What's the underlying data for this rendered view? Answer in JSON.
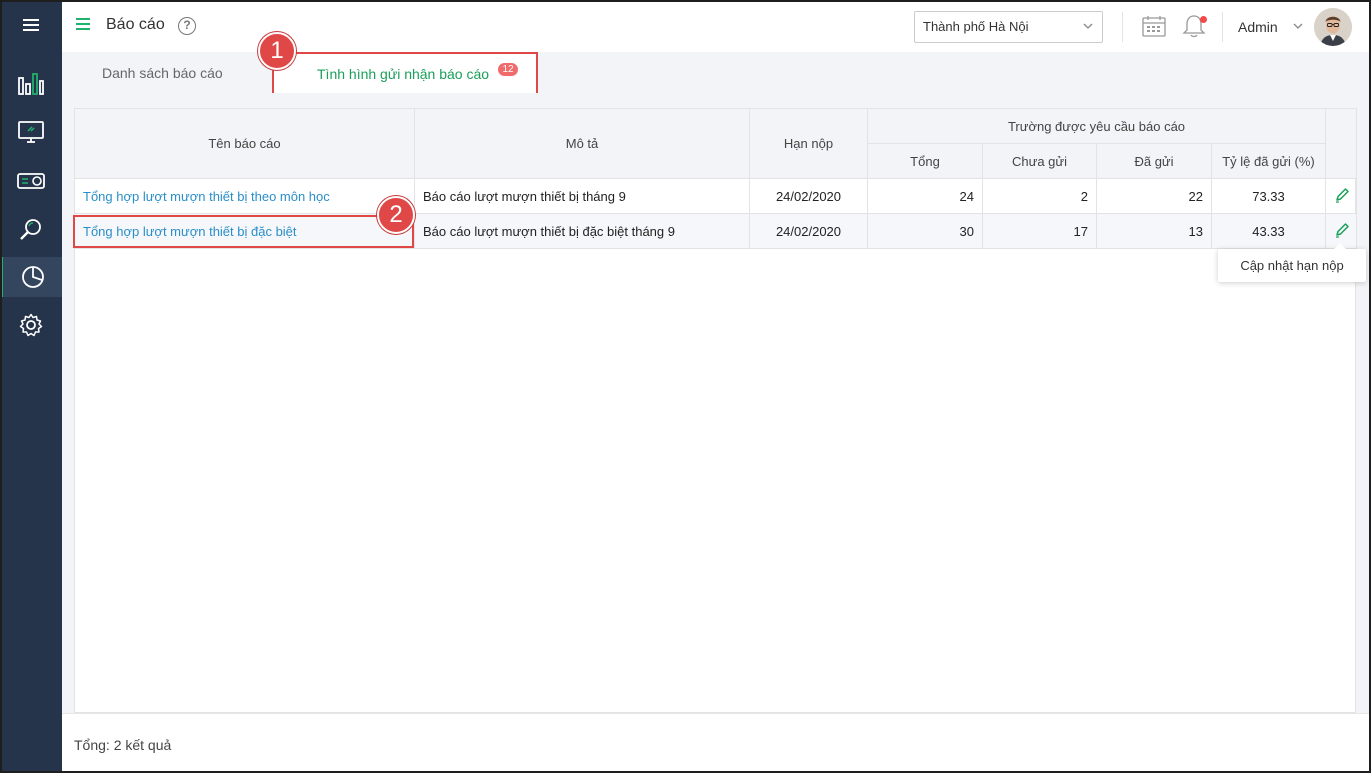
{
  "header": {
    "title": "Báo cáo",
    "help": "?",
    "city_select": "Thành phố Hà Nội",
    "user": "Admin"
  },
  "tabs": [
    {
      "label": "Danh sách báo cáo",
      "active": false
    },
    {
      "label": "Tình hình gửi nhận báo cáo",
      "active": true,
      "badge": "12"
    }
  ],
  "callouts": [
    "1",
    "2"
  ],
  "table": {
    "headers": {
      "name": "Tên báo cáo",
      "desc": "Mô tả",
      "deadline": "Hạn nộp",
      "group": "Trường được yêu cầu báo cáo",
      "total": "Tổng",
      "not_sent": "Chưa gửi",
      "sent": "Đã gửi",
      "ratio": "Tỷ lệ đã gửi (%)"
    },
    "rows": [
      {
        "name": "Tổng hợp lượt mượn thiết bị theo môn học",
        "desc": "Báo cáo lượt mượn thiết bị tháng 9",
        "deadline": "24/02/2020",
        "total": "24",
        "not_sent": "2",
        "sent": "22",
        "ratio": "73.33"
      },
      {
        "name": "Tổng hợp lượt mượn thiết bị đặc biệt",
        "desc": "Báo cáo lượt mượn thiết bị đặc biệt tháng 9",
        "deadline": "24/02/2020",
        "total": "30",
        "not_sent": "17",
        "sent": "13",
        "ratio": "43.33"
      }
    ]
  },
  "tooltip": "Cập nhật hạn nộp",
  "footer": {
    "total": "Tổng: 2 kết quả"
  },
  "colors": {
    "sidebar": "#25344b",
    "accent": "#22b06d",
    "link": "#2a8ec9",
    "highlight": "#e04848"
  },
  "icons": [
    "menu-icon",
    "chart-bars-icon",
    "monitor-icon",
    "projector-icon",
    "search-icon",
    "pie-chart-icon",
    "settings-icon",
    "help-icon",
    "calendar-icon",
    "bell-icon",
    "edit-pencil-icon"
  ]
}
